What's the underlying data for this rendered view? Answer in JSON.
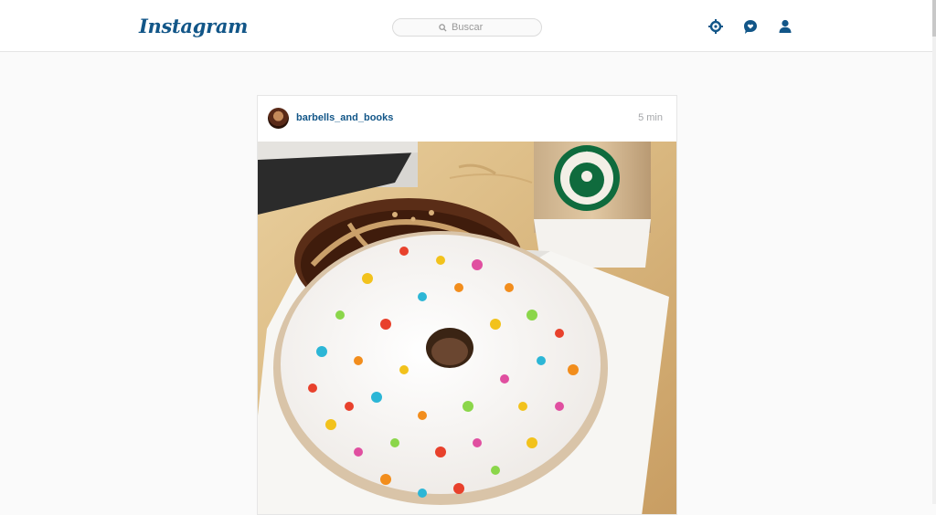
{
  "header": {
    "logo_text": "Instagram",
    "search_placeholder": "Buscar",
    "brand_color": "#125688",
    "icons": [
      "explore-icon",
      "activity-icon",
      "profile-icon"
    ]
  },
  "post": {
    "username": "barbells_and_books",
    "time": "5 min",
    "avatar": "avatar-icon",
    "photo_subject": "donuts-and-coffee-photo"
  }
}
